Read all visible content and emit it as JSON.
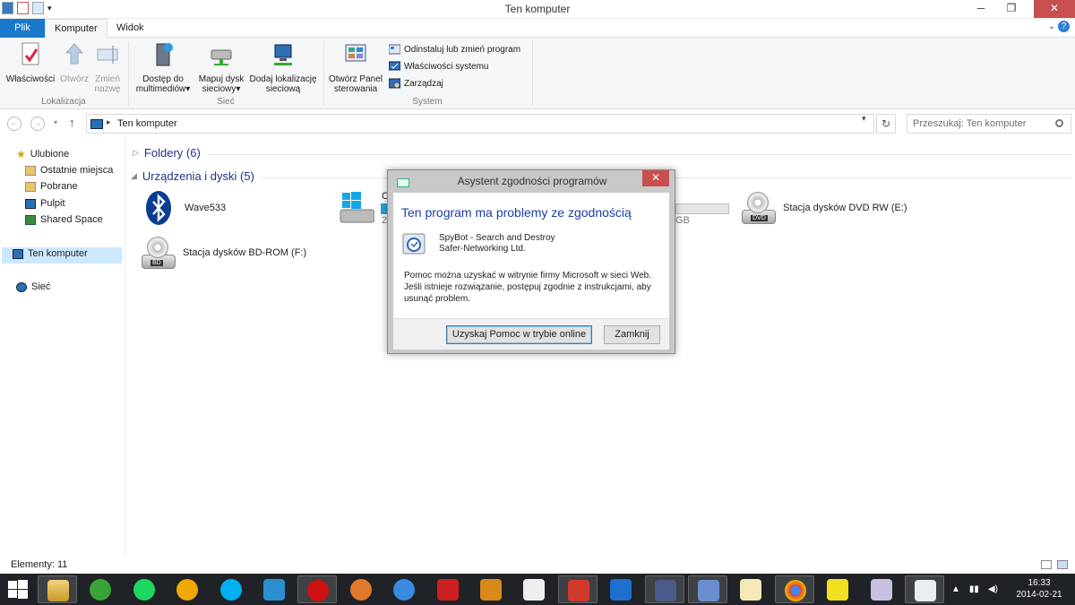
{
  "window": {
    "title": "Ten komputer"
  },
  "ribbon_tabs": [
    "Plik",
    "Komputer",
    "Widok"
  ],
  "ribbon": {
    "groups": [
      {
        "label": "Lokalizacja",
        "buttons": [
          "Właściwości",
          "Otwórz",
          "Zmień nazwę"
        ]
      },
      {
        "label": "Sieć",
        "buttons": [
          "Dostęp do multimediów",
          "Mapuj dysk sieciowy",
          "Dodaj lokalizację sieciową"
        ]
      },
      {
        "label": "System",
        "buttons": [
          "Otwórz Panel sterowania"
        ],
        "small_buttons": [
          "Odinstaluj lub zmień program",
          "Właściwości systemu",
          "Zarządzaj"
        ]
      }
    ],
    "lokalizacja": {
      "wlasciwosci": "Właściwości",
      "otworz": "Otwórz",
      "zmien_1": "Zmień",
      "zmien_2": "nazwę",
      "label": "Lokalizacja"
    },
    "siec": {
      "dostep_1": "Dostęp do",
      "dostep_2": "multimediów",
      "mapuj_1": "Mapuj dysk",
      "mapuj_2": "sieciowy",
      "dodaj_1": "Dodaj lokalizację",
      "dodaj_2": "sieciową",
      "label": "Sieć"
    },
    "system": {
      "panel_1": "Otwórz Panel",
      "panel_2": "sterowania",
      "odinstaluj": "Odinstaluj lub zmień program",
      "wlasciwosci_sys": "Właściwości systemu",
      "zarzadzaj": "Zarządzaj",
      "label": "System"
    }
  },
  "address": {
    "crumb": "Ten komputer",
    "search_placeholder": "Przeszukaj: Ten komputer"
  },
  "nav": {
    "ulubione": "Ulubione",
    "items": [
      "Ostatnie miejsca",
      "Pobrane",
      "Pulpit",
      "Shared Space"
    ],
    "ten_komputer": "Ten komputer",
    "siec": "Sieć"
  },
  "content": {
    "folders": "Foldery (6)",
    "devices": "Urządzenia i dyski (5)",
    "device_list": [
      {
        "name": "Wave533"
      },
      {
        "name": "Stacja dysków DVD RW (E:)"
      },
      {
        "name": "Stacja dysków BD-ROM (F:)"
      }
    ],
    "partial_c_label": "C",
    "partial_c_size": "2",
    "partial_d_size": "GB"
  },
  "dialog": {
    "title": "Asystent zgodności programów",
    "heading": "Ten program ma problemy ze zgodnością",
    "program": "SpyBot - Search and Destroy",
    "publisher": "Safer-Networking Ltd.",
    "text": "Pomoc można uzyskać w witrynie firmy Microsoft w sieci Web. Jeśli istnieje rozwiązanie, postępuj zgodnie z instrukcjami, aby usunąć problem.",
    "btn_online": "Uzyskaj Pomoc w trybie online",
    "btn_close": "Zamknij"
  },
  "status": {
    "count": "Elementy: 11"
  },
  "taskbar": {
    "apps": [
      "file-explorer",
      "utorrent",
      "spotify",
      "aimp",
      "skype",
      "virtualbox",
      "opera",
      "pen-tool",
      "daemon-tools",
      "adobe-reader",
      "gimp",
      "notepad",
      "ccleaner",
      "xmind",
      "video-editor",
      "remote-desktop",
      "screen-capture",
      "chrome",
      "game",
      "paint",
      "task-list"
    ],
    "time": "16:33",
    "date": "2014-02-21"
  },
  "colors": {
    "accent": "#1979ca",
    "close": "#c7504f",
    "heading": "#1a3ea8",
    "selection": "#cce8ff"
  }
}
